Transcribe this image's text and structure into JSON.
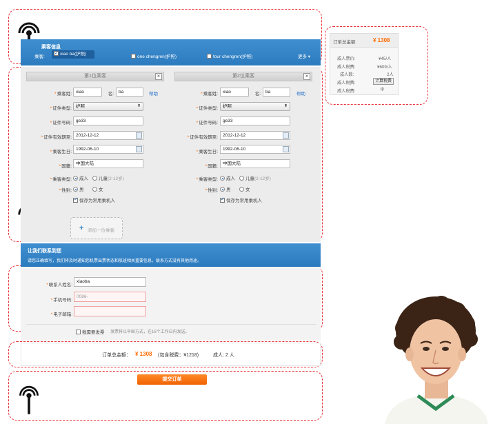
{
  "header": {
    "title": "乘客信息",
    "passenger_label": "乘客:",
    "passengers": [
      {
        "label": "xiao ba(护照)",
        "checked": true
      },
      {
        "label": "one chengren(护照)",
        "checked": false
      },
      {
        "label": "four chengren(护照)",
        "checked": false
      }
    ],
    "more_label": "更多"
  },
  "order_summary": {
    "title": "订单总金额",
    "total": "¥ 1308",
    "rows": [
      {
        "label": "成人票价:",
        "value": "¥45/人"
      },
      {
        "label": "成人税费:",
        "value": "¥609/人"
      },
      {
        "label": "成人数:",
        "value": "2人"
      },
      {
        "label": "成人税费:",
        "button": "计算税费"
      },
      {
        "label": "成人税费:",
        "value": ""
      }
    ]
  },
  "passenger_cards": [
    {
      "title": "第1位乘客",
      "surname_label": "乘客姓:",
      "surname": "xiao",
      "given_label": "名:",
      "given": "ba",
      "help": "帮助",
      "id_type_label": "证件类型:",
      "id_type": "护照",
      "id_number_label": "证件号码:",
      "id_number": "ge33",
      "id_expiry_label": "证件有效期至:",
      "id_expiry": "2012-12-12",
      "birthday_label": "乘客生日:",
      "birthday": "1992-06-10",
      "nationality_label": "国籍:",
      "nationality": "中国大陆",
      "type_label": "乘客类型:",
      "type_adult": "成人",
      "type_child": "儿童",
      "type_child_note": "(2-12岁)",
      "gender_label": "性别:",
      "gender_male": "男",
      "gender_female": "女",
      "save_label": "保存为常用乘机人"
    },
    {
      "title": "第2位乘客",
      "surname_label": "乘客姓:",
      "surname": "xiao",
      "given_label": "名:",
      "given": "ba",
      "help": "帮助",
      "id_type_label": "证件类型:",
      "id_type": "护照",
      "id_number_label": "证件号码:",
      "id_number": "ge33",
      "id_expiry_label": "证件有效期至:",
      "id_expiry": "2012-12-12",
      "birthday_label": "乘客生日:",
      "birthday": "1992-06-10",
      "nationality_label": "国籍:",
      "nationality": "中国大陆",
      "type_label": "乘客类型:",
      "type_adult": "成人",
      "type_child": "儿童",
      "type_child_note": "(2-12岁)",
      "gender_label": "性别:",
      "gender_male": "男",
      "gender_female": "女",
      "save_label": "保存为常用乘机人"
    }
  ],
  "add_passenger_label": "添加一位乘客",
  "contact": {
    "title": "让我们联系到您",
    "subtitle": "请您正确填写，我们将及时通知您机票出票状态和航班相关重要信息，联系方式没有其他用途。",
    "name_label": "联系人姓名:",
    "name_value": "xiaoba",
    "phone_label": "手机号码:",
    "phone_placeholder": "0086-",
    "email_label": "电子邮箱:",
    "email_value": "",
    "invoice_label": "我需要发票",
    "invoice_note": "发票将以平邮方式，在15个工作日内发送。"
  },
  "total_bar": {
    "label": "订单总金额：",
    "amount": "¥ 1308",
    "tax_note": "(包含税费：¥1218)",
    "adults": "成人: 2 人"
  },
  "submit_label": "提交订单",
  "colors": {
    "accent_orange": "#ff6a00",
    "header_blue": "#3a88cc",
    "annotation_red": "#e8333a"
  }
}
